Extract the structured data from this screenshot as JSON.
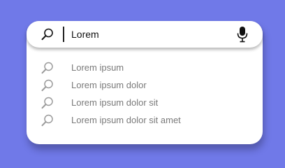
{
  "search": {
    "query": "Lorem",
    "icon": "search-icon",
    "voice_icon": "microphone-icon"
  },
  "suggestions": [
    {
      "label": "Lorem ipsum",
      "icon": "search-icon"
    },
    {
      "label": "Lorem ipsum dolor",
      "icon": "search-icon"
    },
    {
      "label": "Lorem ipsum dolor sit",
      "icon": "search-icon"
    },
    {
      "label": "Lorem ipsum dolor sit amet",
      "icon": "search-icon"
    }
  ],
  "colors": {
    "background": "#7079e8",
    "panel": "#ffffff",
    "suggestion_text": "#7a7a7a",
    "query_text": "#111111"
  }
}
